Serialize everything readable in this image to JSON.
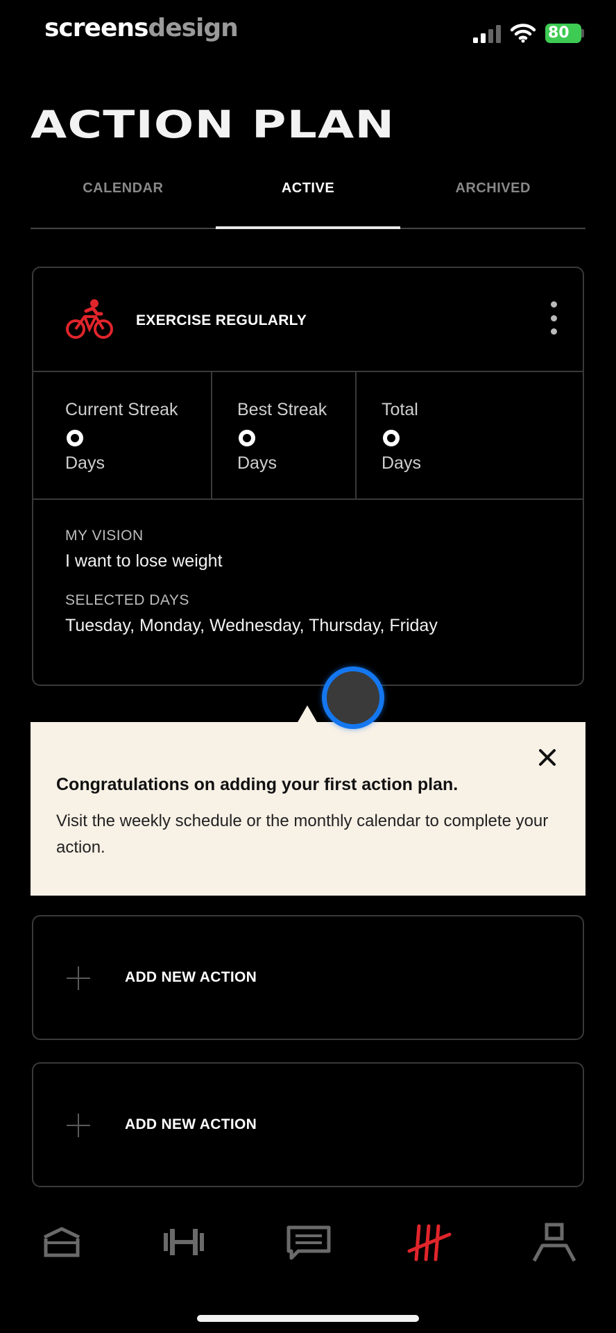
{
  "status_bar": {
    "brand_part1": "screens",
    "brand_part2": "design",
    "battery": "80"
  },
  "page": {
    "title": "ACTION PLAN"
  },
  "tabs": [
    {
      "label": "CALENDAR",
      "active": false
    },
    {
      "label": "ACTIVE",
      "active": true
    },
    {
      "label": "ARCHIVED",
      "active": false
    }
  ],
  "action_card": {
    "icon": "bike-icon",
    "title": "EXERCISE REGULARLY",
    "stats": [
      {
        "label": "Current Streak",
        "unit": "Days"
      },
      {
        "label": "Best Streak",
        "unit": "Days"
      },
      {
        "label": "Total",
        "unit": "Days"
      }
    ],
    "vision_label": "MY VISION",
    "vision_text": "I want to lose weight",
    "days_label": "SELECTED DAYS",
    "days_text": "Tuesday, Monday, Wednesday, Thursday, Friday"
  },
  "tooltip": {
    "title": "Congratulations on adding your first action plan.",
    "body": "Visit the weekly schedule or the monthly calendar to complete your action."
  },
  "add_actions": [
    {
      "label": "ADD NEW ACTION"
    },
    {
      "label": "ADD NEW ACTION"
    }
  ],
  "bottom_nav": [
    {
      "icon": "home-icon",
      "active": false
    },
    {
      "icon": "dumbbell-icon",
      "active": false
    },
    {
      "icon": "chat-icon",
      "active": false
    },
    {
      "icon": "tally-icon",
      "active": true
    },
    {
      "icon": "profile-icon",
      "active": false
    }
  ],
  "colors": {
    "accent": "#e0252b",
    "background": "#000000",
    "tooltip_bg": "#f8f1e6",
    "cursor_ring": "#1477f0",
    "battery": "#3ecb53"
  }
}
